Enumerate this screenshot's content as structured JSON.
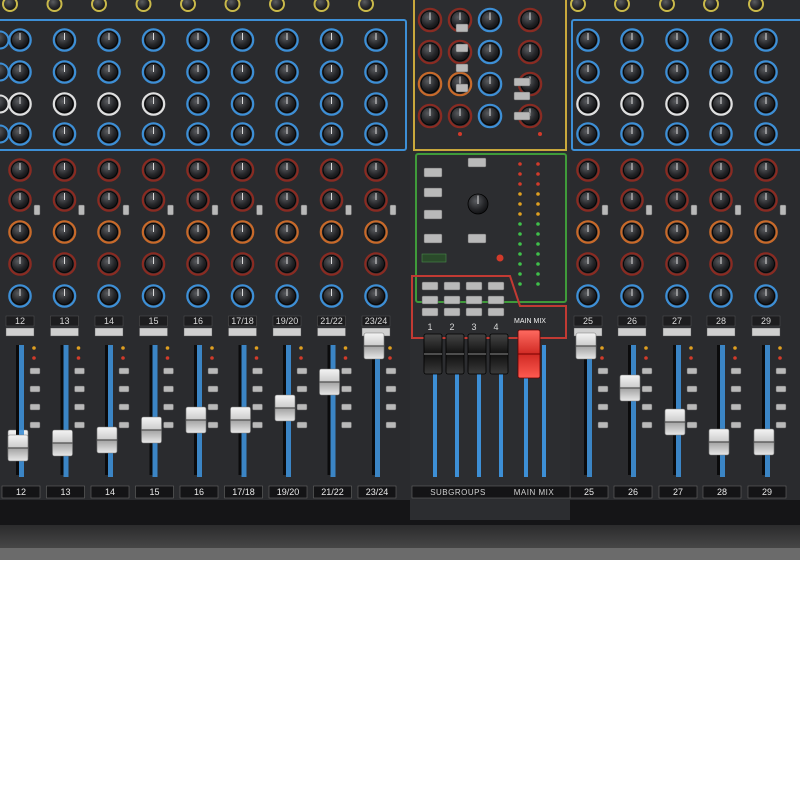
{
  "scene": {
    "subject": "mixer-console",
    "colors": {
      "panel": "#2a2b2e",
      "eq_outline": "#3d8fd6",
      "master_outline_yellow": "#c9a83c",
      "master_outline_green": "#3f9b3a",
      "subgroup_outline_red": "#c23a33",
      "main_fader_cap": "#e53a33"
    }
  },
  "strips": [
    {
      "number": "12",
      "bottom_label": "12"
    },
    {
      "number": "13",
      "bottom_label": "13"
    },
    {
      "number": "14",
      "bottom_label": "14"
    },
    {
      "number": "15",
      "bottom_label": "15"
    },
    {
      "number": "16",
      "bottom_label": "16"
    },
    {
      "number": "17/18",
      "bottom_label": "17/18"
    },
    {
      "number": "19/20",
      "bottom_label": "19/20"
    },
    {
      "number": "21/22",
      "bottom_label": "21/22"
    },
    {
      "number": "23/24",
      "bottom_label": "23/24"
    },
    {
      "number": "25",
      "bottom_label": "25"
    },
    {
      "number": "26",
      "bottom_label": "26"
    },
    {
      "number": "27",
      "bottom_label": "27"
    },
    {
      "number": "28",
      "bottom_label": "28"
    },
    {
      "number": "29",
      "bottom_label": "29"
    }
  ],
  "subgroups": {
    "numbers": [
      "1",
      "2",
      "3",
      "4"
    ],
    "label": "SUBGROUPS"
  },
  "main_mix": {
    "top_label": "MAIN MIX",
    "bottom_label": "MAIN MIX"
  }
}
